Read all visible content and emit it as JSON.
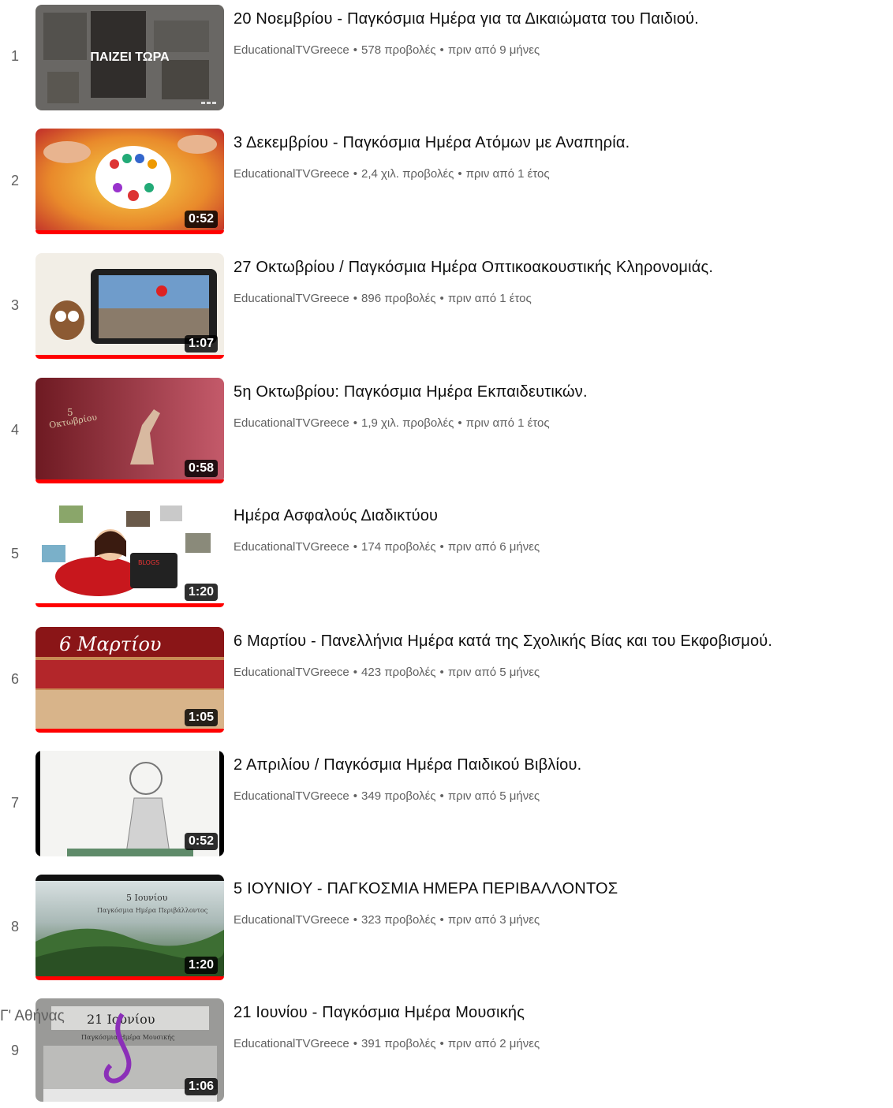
{
  "overlay_text": "Γ' Αθήνας",
  "now_playing_label": "ΠΑΙΖΕΙ ΤΩΡΑ",
  "items": [
    {
      "index": "1",
      "title": "20 Νοεμβρίου - Παγκόσμια Ημέρα για τα Δικαιώματα του Παιδιού.",
      "channel": "EducationalTVGreece",
      "views": "578 προβολές",
      "age": "πριν από 9 μήνες",
      "duration": "",
      "now_playing": true
    },
    {
      "index": "2",
      "title": "3 Δεκεμβρίου - Παγκόσμια Ημέρα Ατόμων με Αναπηρία.",
      "channel": "EducationalTVGreece",
      "views": "2,4 χιλ. προβολές",
      "age": "πριν από 1 έτος",
      "duration": "0:52",
      "progress": 1.0
    },
    {
      "index": "3",
      "title": "27 Οκτωβρίου / Παγκόσμια Ημέρα Οπτικοακουστικής Κληρονομιάς.",
      "channel": "EducationalTVGreece",
      "views": "896 προβολές",
      "age": "πριν από 1 έτος",
      "duration": "1:07",
      "progress": 1.0
    },
    {
      "index": "4",
      "title": "5η Οκτωβρίου: Παγκόσμια Ημέρα Εκπαιδευτικών.",
      "channel": "EducationalTVGreece",
      "views": "1,9 χιλ. προβολές",
      "age": "πριν από 1 έτος",
      "duration": "0:58",
      "progress": 1.0
    },
    {
      "index": "5",
      "title": "Ημέρα Ασφαλούς Διαδικτύου",
      "channel": "EducationalTVGreece",
      "views": "174 προβολές",
      "age": "πριν από 6 μήνες",
      "duration": "1:20",
      "progress": 1.0
    },
    {
      "index": "6",
      "title": "6 Μαρτίου - Πανελλήνια Ημέρα κατά της Σχολικής Βίας και του Εκφοβισμού.",
      "channel": "EducationalTVGreece",
      "views": "423 προβολές",
      "age": "πριν από 5 μήνες",
      "duration": "1:05",
      "progress": 1.0
    },
    {
      "index": "7",
      "title": "2 Απριλίου / Παγκόσμια Ημέρα Παιδικού Βιβλίου.",
      "channel": "EducationalTVGreece",
      "views": "349 προβολές",
      "age": "πριν από 5 μήνες",
      "duration": "0:52",
      "progress": 0.0
    },
    {
      "index": "8",
      "title": "5 ΙΟΥΝΙΟΥ - ΠΑΓΚΟΣΜΙΑ ΗΜΕΡΑ ΠΕΡΙΒΑΛΛΟΝΤΟΣ",
      "channel": "EducationalTVGreece",
      "views": "323 προβολές",
      "age": "πριν από 3 μήνες",
      "duration": "1:20",
      "progress": 1.0
    },
    {
      "index": "9",
      "title": "21 Ιουνίου - Παγκόσμια Ημέρα Μουσικής",
      "channel": "EducationalTVGreece",
      "views": "391 προβολές",
      "age": "πριν από 2 μήνες",
      "duration": "1:06",
      "progress": 0.0
    }
  ],
  "thumb_text": {
    "t4_line1": "5",
    "t4_line2": "Οκτωβρίου",
    "t6_title": "6 Μαρτίου",
    "t8_line1": "5 Ιουνίου",
    "t8_line2": "Παγκόσμια Ημέρα Περιβάλλοντος",
    "t9_line1": "21 Ιουνίου",
    "t9_line2": "Παγκόσμια Ημέρα Μουσικής",
    "t5_screen": "BLOGS"
  }
}
